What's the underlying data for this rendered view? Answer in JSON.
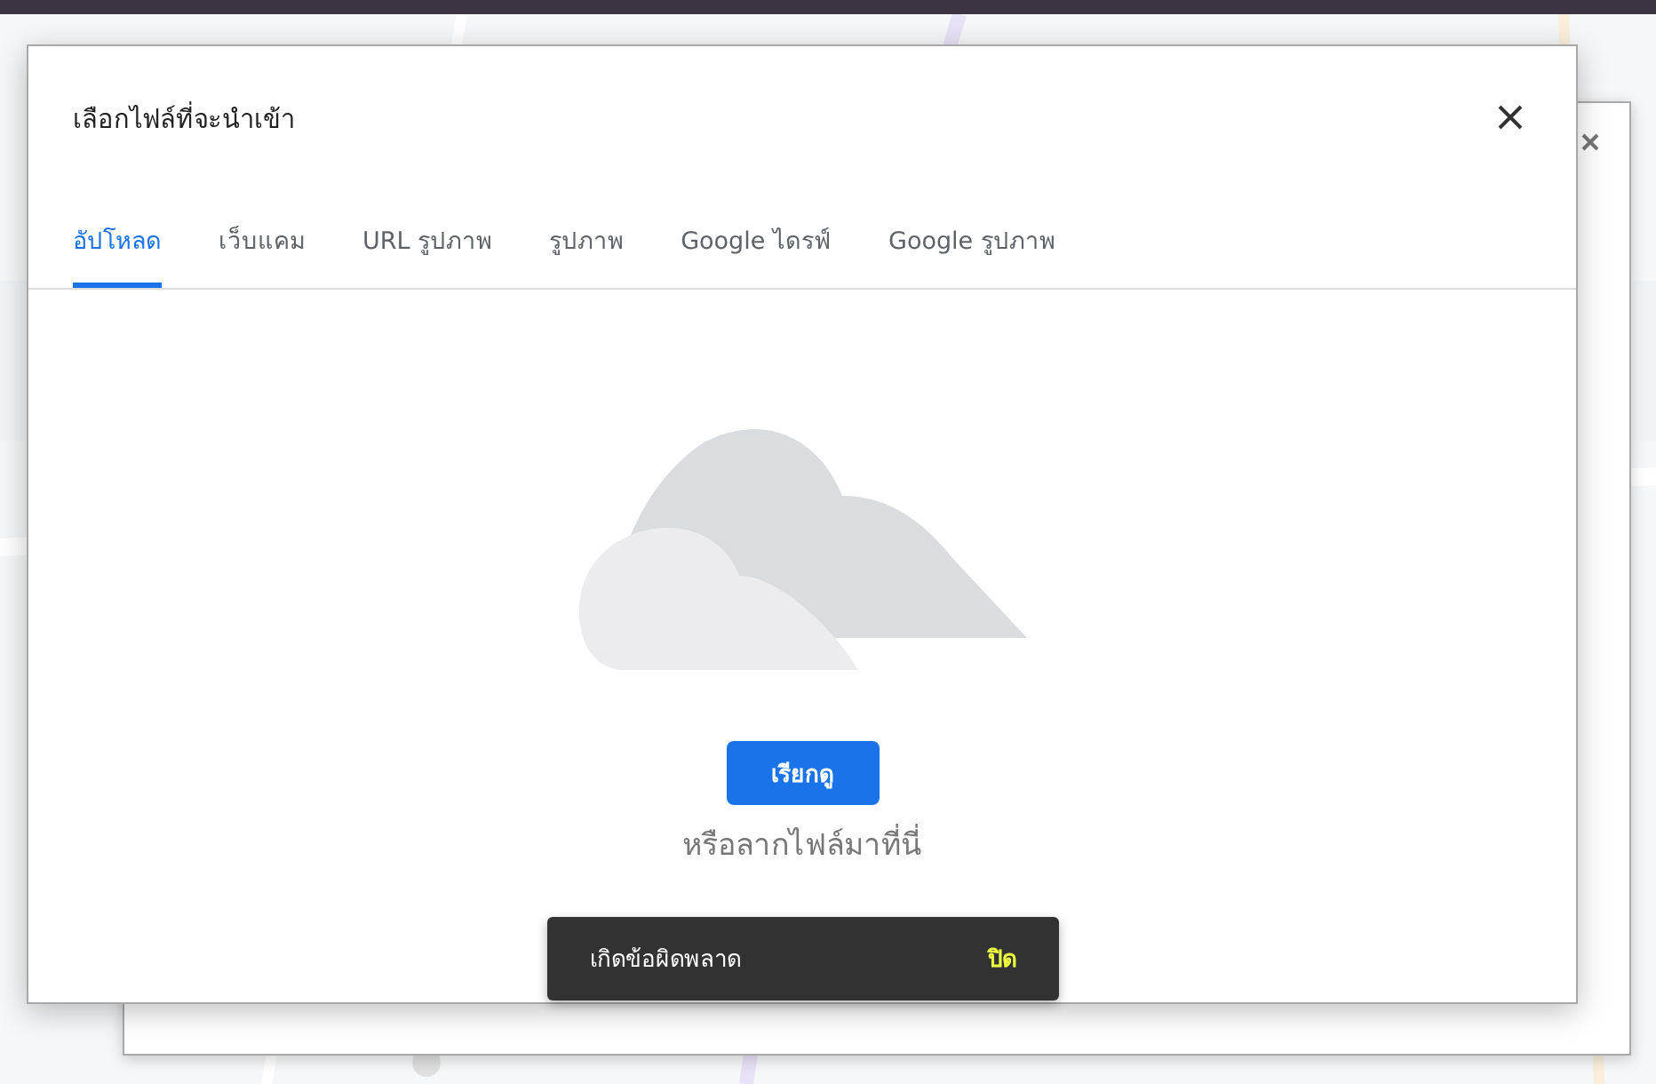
{
  "dialog": {
    "title": "เลือกไฟล์ที่จะนำเข้า",
    "tabs": [
      {
        "label": "อัปโหลด",
        "selected": true
      },
      {
        "label": "เว็บแคม",
        "selected": false
      },
      {
        "label": "URL รูปภาพ",
        "selected": false
      },
      {
        "label": "รูปภาพ",
        "selected": false
      },
      {
        "label": "Google ไดรฟ์",
        "selected": false
      },
      {
        "label": "Google รูปภาพ",
        "selected": false
      }
    ],
    "browse_button": "เรียกดู",
    "drop_hint": "หรือลากไฟล์มาที่นี่"
  },
  "snackbar": {
    "message": "เกิดข้อผิดพลาด",
    "action": "ปิด"
  }
}
